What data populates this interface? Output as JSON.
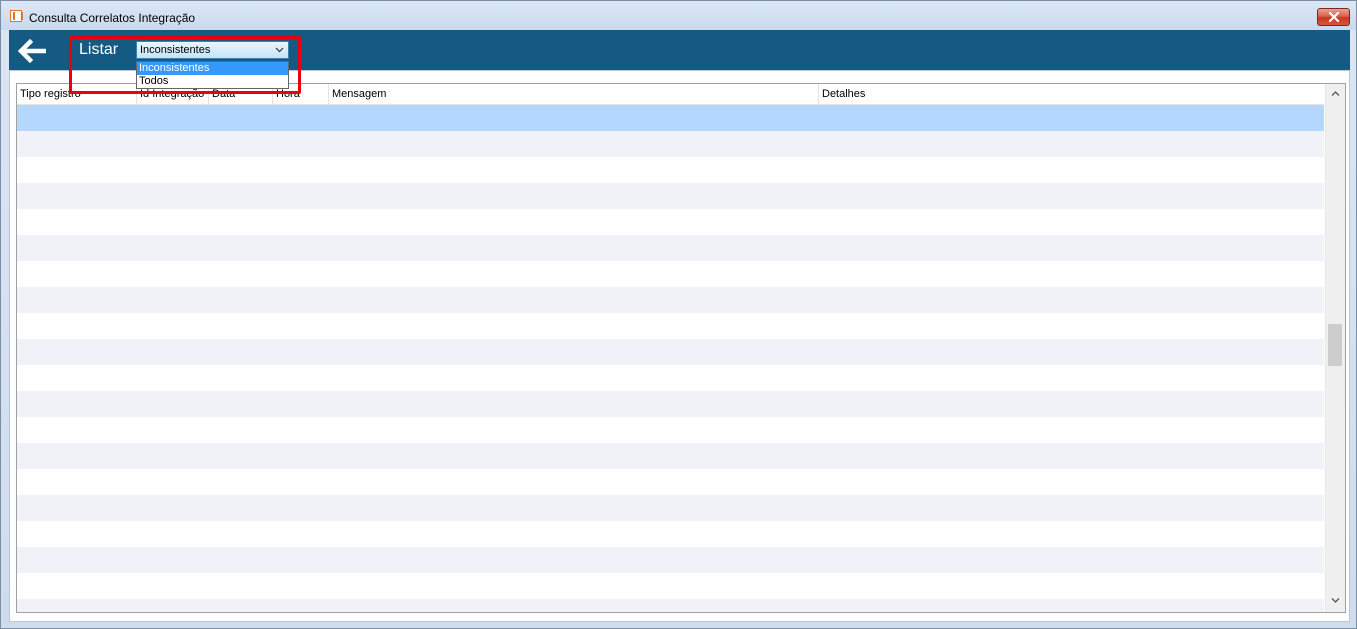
{
  "window": {
    "title": "Consulta Correlatos Integração"
  },
  "header": {
    "listar_label": "Listar",
    "filter": {
      "selected": "Inconsistentes",
      "options": [
        "Inconsistentes",
        "Todos"
      ]
    }
  },
  "grid": {
    "columns": [
      "Tipo registro",
      "Id Integração",
      "Data",
      "Hora",
      "Mensagem",
      "Detalhes"
    ],
    "rows": []
  },
  "colors": {
    "header_bar": "#155a82",
    "selected_row": "#b3d7fd",
    "alt_row": "#f1f2f7",
    "highlight": "#e8000f",
    "dropdown_selected": "#3399ff"
  },
  "icons": {
    "back": "arrow-left-icon",
    "close": "close-icon",
    "app": "app-icon",
    "combo": "chevron-down-icon",
    "scroll_up": "chevron-up-icon",
    "scroll_down": "chevron-down-icon"
  }
}
